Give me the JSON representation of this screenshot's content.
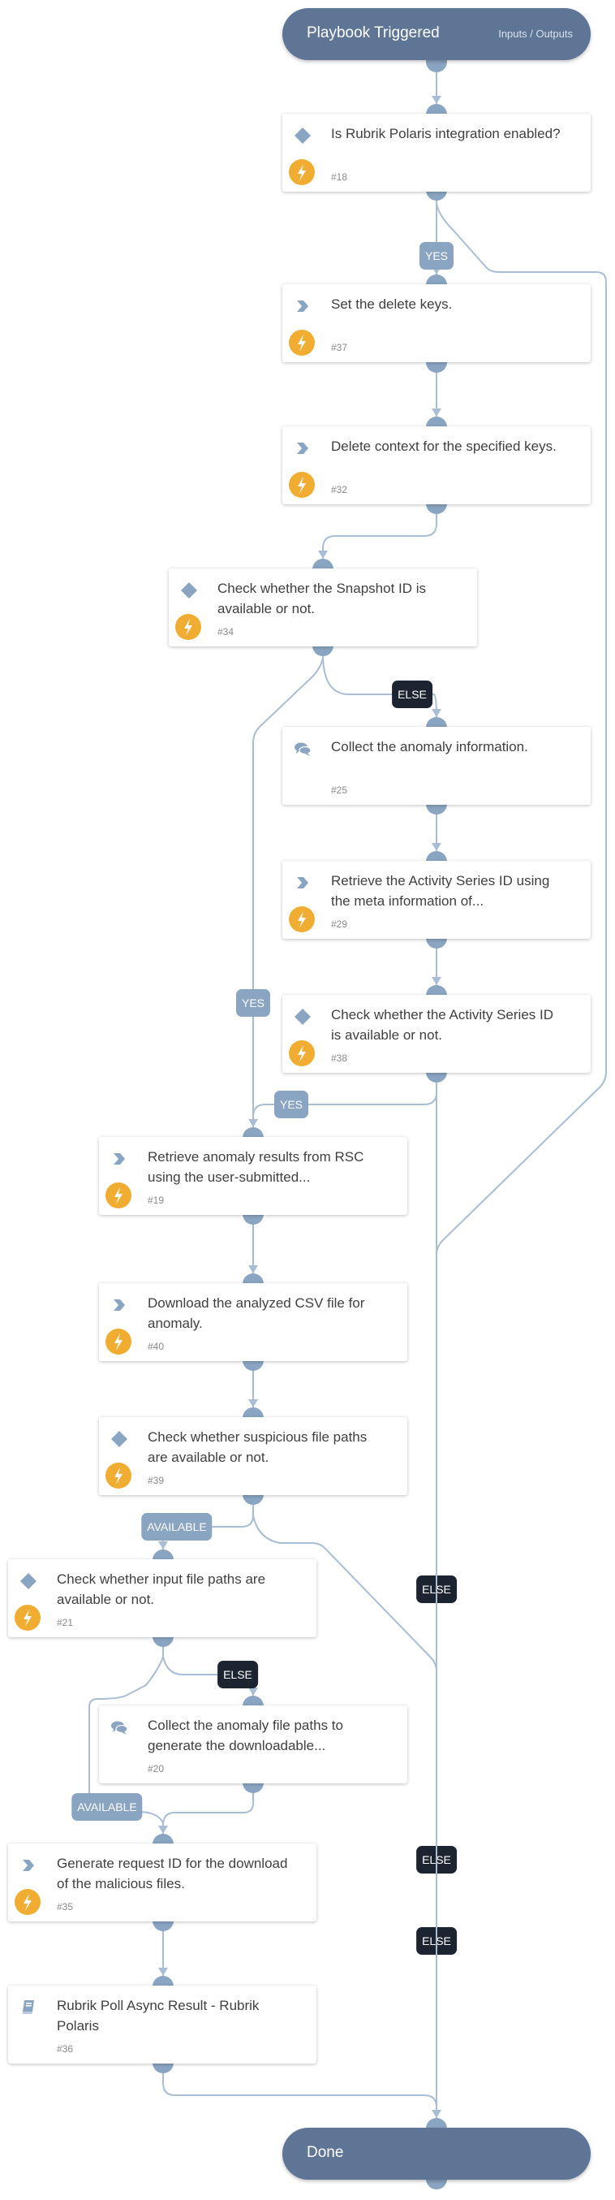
{
  "start": {
    "title": "Playbook Triggered",
    "io_link": "Inputs / Outputs"
  },
  "end": {
    "title": "Done"
  },
  "tasks": [
    {
      "id": "18",
      "title": "Is Rubrik Polaris integration enabled?",
      "number": "#18",
      "type": "condition",
      "automated": true
    },
    {
      "id": "37",
      "title": "Set the delete keys.",
      "number": "#37",
      "type": "action",
      "automated": true
    },
    {
      "id": "32",
      "title": "Delete context for the specified keys.",
      "number": "#32",
      "type": "action",
      "automated": true
    },
    {
      "id": "34",
      "title": "Check whether the Snapshot ID is available or not.",
      "number": "#34",
      "type": "condition",
      "automated": true
    },
    {
      "id": "25",
      "title": "Collect the anomaly information.",
      "number": "#25",
      "type": "data-collection",
      "automated": false
    },
    {
      "id": "29",
      "title": "Retrieve the Activity Series ID using the meta information of...",
      "number": "#29",
      "type": "action",
      "automated": true
    },
    {
      "id": "38",
      "title": "Check whether the Activity Series ID is available or not.",
      "number": "#38",
      "type": "condition",
      "automated": true
    },
    {
      "id": "19",
      "title": "Retrieve anomaly results from RSC using the user-submitted...",
      "number": "#19",
      "type": "action",
      "automated": true
    },
    {
      "id": "40",
      "title": "Download the analyzed CSV file for anomaly.",
      "number": "#40",
      "type": "action",
      "automated": true
    },
    {
      "id": "39",
      "title": "Check whether suspicious file paths are available or not.",
      "number": "#39",
      "type": "condition",
      "automated": true
    },
    {
      "id": "21",
      "title": "Check whether input file paths are available or not.",
      "number": "#21",
      "type": "condition",
      "automated": true
    },
    {
      "id": "20",
      "title": "Collect the anomaly file paths to generate the downloadable...",
      "number": "#20",
      "type": "data-collection",
      "automated": false
    },
    {
      "id": "35",
      "title": "Generate request ID for the download of the malicious files.",
      "number": "#35",
      "type": "action",
      "automated": true
    },
    {
      "id": "36",
      "title": "Rubrik Poll Async Result - Rubrik Polaris",
      "number": "#36",
      "type": "playbook",
      "automated": false
    }
  ],
  "edge_labels": [
    {
      "text": "YES",
      "kind": "condition",
      "from": "18",
      "to": "37"
    },
    {
      "text": "ELSE",
      "kind": "else",
      "from": "34",
      "to": "25"
    },
    {
      "text": "YES",
      "kind": "condition",
      "from": "34",
      "to": "19"
    },
    {
      "text": "YES",
      "kind": "condition",
      "from": "38",
      "to": "19"
    },
    {
      "text": "AVAILABLE",
      "kind": "condition",
      "from": "39",
      "to": "21"
    },
    {
      "text": "ELSE",
      "kind": "else",
      "from": "39",
      "to": "done"
    },
    {
      "text": "ELSE",
      "kind": "else",
      "from": "21",
      "to": "20"
    },
    {
      "text": "AVAILABLE",
      "kind": "condition",
      "from": "21",
      "to": "35"
    },
    {
      "text": "ELSE",
      "kind": "else",
      "from": "38",
      "to": "done"
    },
    {
      "text": "ELSE",
      "kind": "else",
      "from": "18",
      "to": "done"
    }
  ],
  "colors": {
    "pill": "#5f7596",
    "port": "#8aa5c2",
    "edge": "#a9bdd4",
    "condition_label": "#8aa5c2",
    "else_label": "#1c2331",
    "automation_badge": "#f0ad32"
  }
}
